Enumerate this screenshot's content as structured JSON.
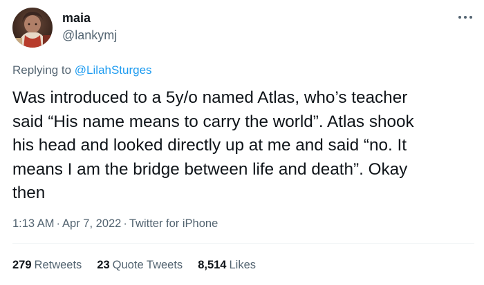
{
  "author": {
    "display_name": "maia",
    "username": "@lankymj"
  },
  "reply": {
    "prefix": "Replying to",
    "handle": "@LilahSturges"
  },
  "body_lines": [
    "Was introduced to a 5y/o named Atlas, who’s teacher",
    "said “His name means to carry the world”. Atlas shook",
    "his head and looked directly up at me and said “no. It",
    "means I am the bridge between life and death”. Okay",
    "then"
  ],
  "meta": {
    "time": "1:13 AM",
    "separator": "·",
    "date": "Apr 7, 2022",
    "source": "Twitter for iPhone"
  },
  "stats": {
    "retweets_count": "279",
    "retweets_label": "Retweets",
    "quotes_count": "23",
    "quotes_label": "Quote Tweets",
    "likes_count": "8,514",
    "likes_label": "Likes"
  },
  "icons": {
    "more": "more-horizontal-icon"
  },
  "colors": {
    "link": "#1d9bf0",
    "secondary_text": "#536471",
    "primary_text": "#0f1419"
  }
}
